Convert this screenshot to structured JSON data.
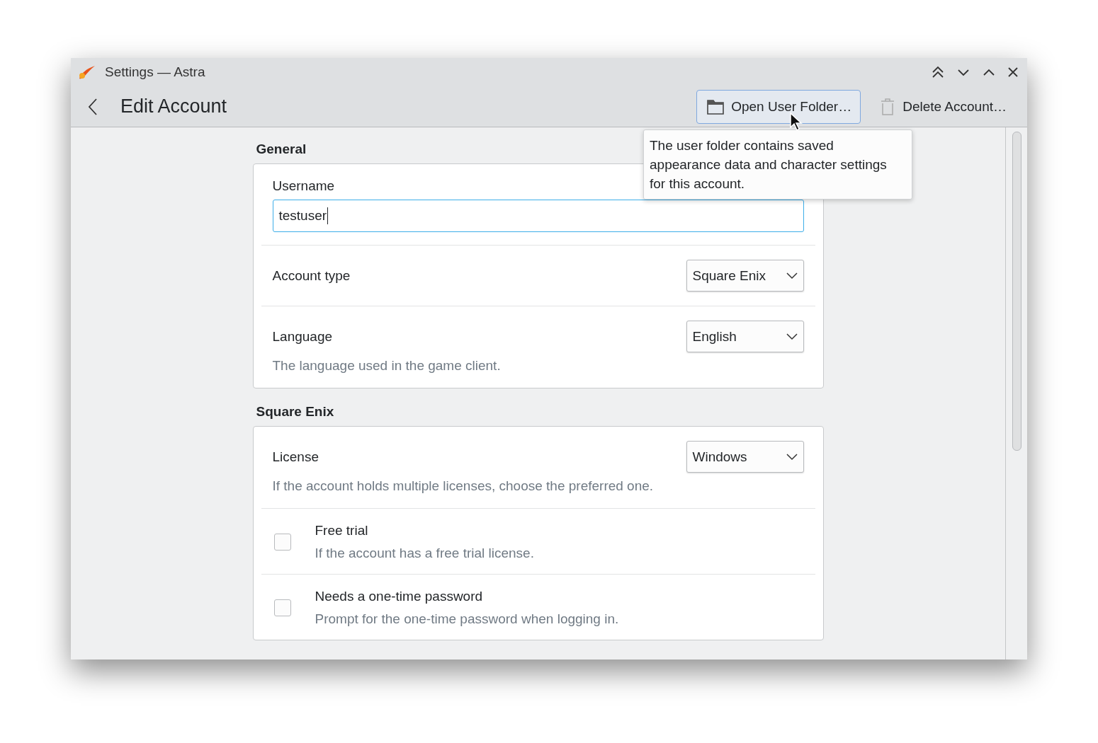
{
  "window": {
    "title": "Settings — Astra"
  },
  "header": {
    "title": "Edit Account",
    "buttons": [
      {
        "label": "Open User Folder…",
        "kind": "folder",
        "focused": true
      },
      {
        "label": "Delete Account…",
        "kind": "trash",
        "focused": false
      }
    ]
  },
  "tooltip": {
    "text": "The user folder contains saved appearance data and character settings for this account."
  },
  "sections": [
    {
      "title": "General",
      "rows": [
        {
          "kind": "text",
          "label": "Username",
          "value": "testuser"
        },
        {
          "kind": "combo",
          "label": "Account type",
          "value": "Square Enix"
        },
        {
          "kind": "combo",
          "label": "Language",
          "value": "English",
          "description": "The language used in the game client."
        }
      ]
    },
    {
      "title": "Square Enix",
      "rows": [
        {
          "kind": "combo",
          "label": "License",
          "value": "Windows",
          "description": "If the account holds multiple licenses, choose the preferred one."
        },
        {
          "kind": "checkbox",
          "label": "Free trial",
          "description": "If the account has a free trial license.",
          "checked": false
        },
        {
          "kind": "checkbox",
          "label": "Needs a one-time password",
          "description": "Prompt for the one-time password when logging in.",
          "checked": false
        }
      ]
    }
  ]
}
